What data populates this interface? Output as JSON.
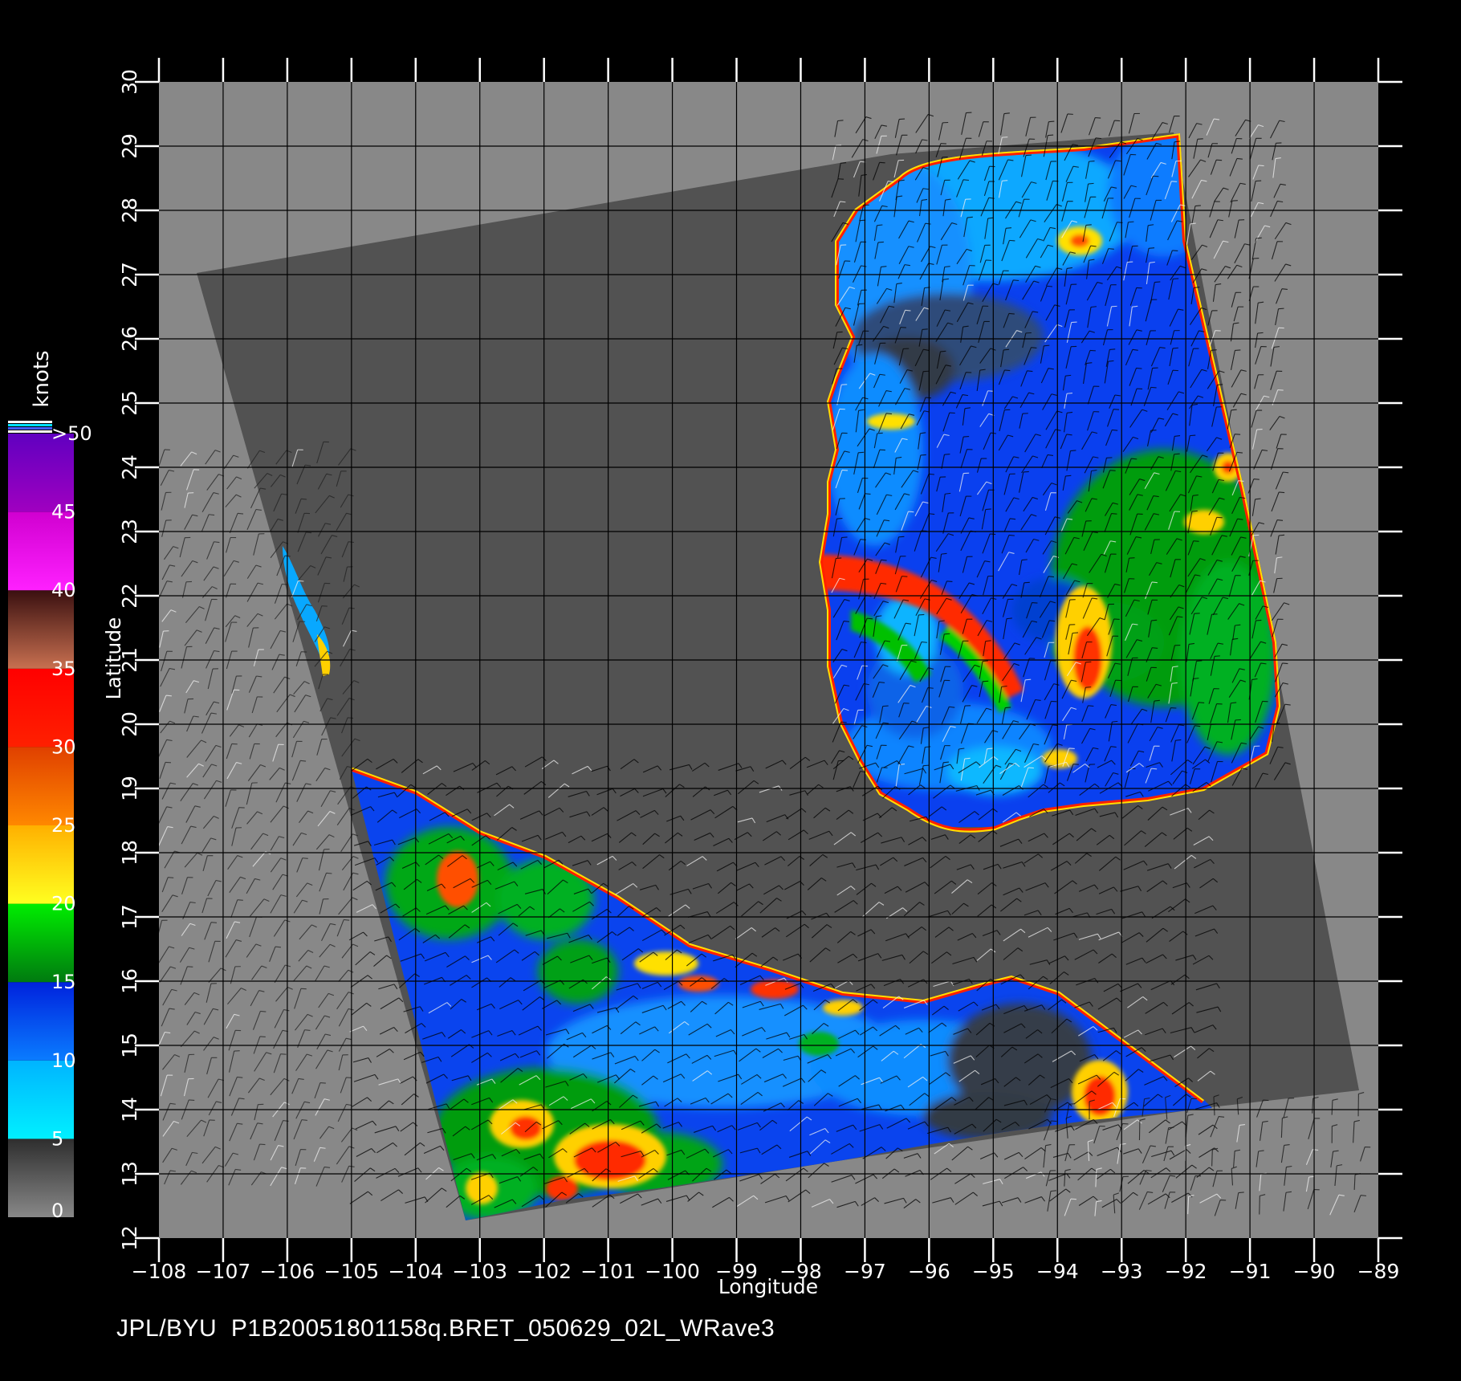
{
  "map": {
    "xaxis": {
      "label": "Longitude",
      "ticks": [
        "-108",
        "-107",
        "-106",
        "-105",
        "-104",
        "-103",
        "-102",
        "-101",
        "-100",
        "-99",
        "-98",
        "-97",
        "-96",
        "-95",
        "-94",
        "-93",
        "-92",
        "-91",
        "-90",
        "-89"
      ],
      "range": [
        -108,
        -89
      ]
    },
    "yaxis": {
      "label": "Latitude",
      "ticks": [
        "12",
        "13",
        "14",
        "15",
        "16",
        "17",
        "18",
        "19",
        "20",
        "21",
        "22",
        "23",
        "24",
        "25",
        "26",
        "27",
        "28",
        "29",
        "30"
      ],
      "range": [
        12,
        30
      ]
    },
    "grid": true,
    "colorbar": {
      "title": "knots",
      "tick_labels": [
        "0",
        "5",
        "10",
        "15",
        "20",
        "25",
        "30",
        "35",
        "40",
        "45",
        ">50"
      ],
      "bands": [
        {
          "from": 0,
          "to": 5,
          "colors": [
            "#888888",
            "#2e2e2e"
          ]
        },
        {
          "from": 5,
          "to": 10,
          "colors": [
            "#00f0ff",
            "#00b4ff"
          ]
        },
        {
          "from": 10,
          "to": 15,
          "colors": [
            "#0a7cff",
            "#0022dd"
          ]
        },
        {
          "from": 15,
          "to": 20,
          "colors": [
            "#007a10",
            "#00ee00"
          ]
        },
        {
          "from": 20,
          "to": 25,
          "colors": [
            "#ffff20",
            "#ffb000"
          ]
        },
        {
          "from": 25,
          "to": 30,
          "colors": [
            "#ff8800",
            "#e04000"
          ]
        },
        {
          "from": 30,
          "to": 35,
          "colors": [
            "#ff2000",
            "#ff0000"
          ]
        },
        {
          "from": 35,
          "to": 40,
          "colors": [
            "#c87050",
            "#3a1010"
          ]
        },
        {
          "from": 40,
          "to": 45,
          "colors": [
            "#ff20ff",
            "#d000d0"
          ]
        },
        {
          "from": 45,
          "to": 50,
          "colors": [
            "#a000c0",
            "#6000c0"
          ]
        }
      ]
    },
    "colors": {
      "background": "#000000",
      "land_gray": "#888888",
      "swath_gray": "#525252",
      "grid": "#000000",
      "frame_ticks": "#ffffff"
    }
  },
  "footer": {
    "text": "JPL/BYU  P1B20051801158q.BRET_050629_02L_WRave3"
  }
}
